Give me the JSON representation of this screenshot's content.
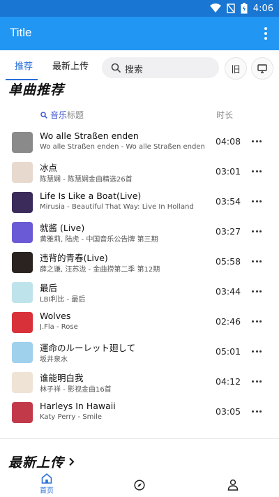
{
  "status": {
    "time": "4:06"
  },
  "app": {
    "title": "Title"
  },
  "tabs": [
    {
      "label": "推荐",
      "active": true
    },
    {
      "label": "最新上传",
      "active": false
    }
  ],
  "search": {
    "placeholder": "搜索"
  },
  "buttons": {
    "old_label": "旧",
    "monitor_icon": "monitor-icon"
  },
  "section_single": {
    "title": "单曲推荐"
  },
  "columns": {
    "music_word": "音乐",
    "title_word": "标题",
    "duration": "时长"
  },
  "songs": [
    {
      "title": "Wo alle Straßen enden",
      "subtitle": "Wo alle Straßen enden - Wo alle Straßen enden",
      "duration": "04:08",
      "cover_color": "#8a8a8a"
    },
    {
      "title": "冰点",
      "subtitle": "陈慧娴 - 陈慧娴金曲精选26首",
      "duration": "03:01",
      "cover_color": "#e8d9cf"
    },
    {
      "title": "Life Is Like a Boat(Live)",
      "subtitle": "Mirusia - Beautiful That Way: Live In Holland",
      "duration": "03:54",
      "cover_color": "#3a2b5a"
    },
    {
      "title": "就酱 (Live)",
      "subtitle": "黄雅莉, 陆虎 - 中国音乐公告牌 第三期",
      "duration": "03:27",
      "cover_color": "#6a5ad6"
    },
    {
      "title": "违背的青春(Live)",
      "subtitle": "薛之谦, 汪苏泷 - 金曲捞第二季 第12期",
      "duration": "05:58",
      "cover_color": "#2a2320"
    },
    {
      "title": "最后",
      "subtitle": "LBI利比 - 最后",
      "duration": "03:44",
      "cover_color": "#bfe3ea"
    },
    {
      "title": "Wolves",
      "subtitle": "J.Fla - Rose",
      "duration": "02:46",
      "cover_color": "#d9313a"
    },
    {
      "title": "運命のルーレット廻して",
      "subtitle": "坂井泉水",
      "duration": "05:01",
      "cover_color": "#9fd0ec"
    },
    {
      "title": "谁能明白我",
      "subtitle": "林子祥 - 影视金曲16首",
      "duration": "04:12",
      "cover_color": "#efe3d6"
    },
    {
      "title": "Harleys In Hawaii",
      "subtitle": "Katy Perry - Smile",
      "duration": "03:05",
      "cover_color": "#c23a4a"
    }
  ],
  "section_latest": {
    "title": "最新上传",
    "chevron": "chevron-right-icon"
  },
  "bottom_nav": {
    "home_label": "首页",
    "compass_icon": "compass-icon",
    "person_icon": "person-icon"
  },
  "colors": {
    "status_bar": "#1976d2",
    "app_bar": "#2196f3",
    "accent": "#2a6fd9"
  }
}
